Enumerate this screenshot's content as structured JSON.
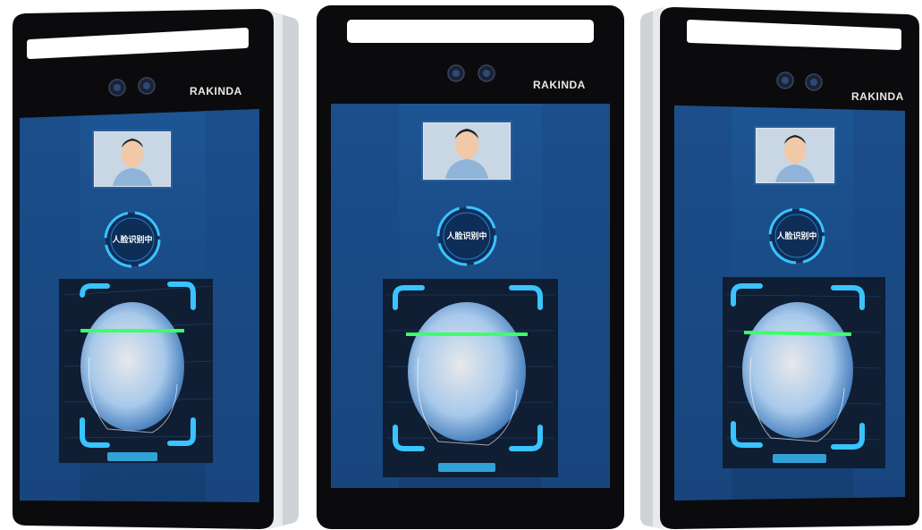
{
  "brand": "RAKINDA",
  "devices": [
    {
      "brand": "RAKINDA",
      "status": "人脸识别中"
    },
    {
      "brand": "RAKINDA",
      "status": "人脸识别中"
    },
    {
      "brand": "RAKINDA",
      "status": "人脸识别中"
    }
  ],
  "colors": {
    "bezel": "#0b0b0d",
    "screen": "#1c4f8c",
    "screen_dark": "#123a6a",
    "accent_cyan": "#39c3ff",
    "scan_line": "#3dff6a",
    "side_frame": "#cfd2d6"
  }
}
